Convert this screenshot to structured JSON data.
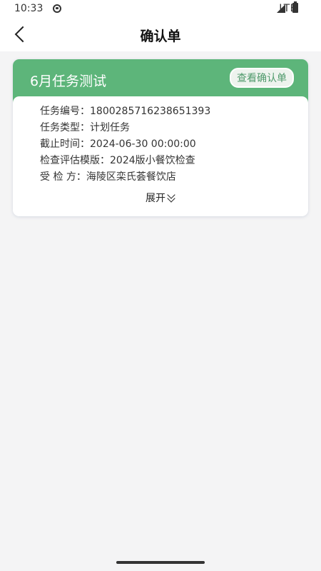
{
  "status_bar": {
    "time": "10:33",
    "network": "LTE",
    "icons": [
      "app-notification-icon",
      "signal-icon",
      "battery-icon"
    ]
  },
  "nav": {
    "title": "确认单",
    "back_icon": "chevron-left-icon"
  },
  "card": {
    "title": "6月任务测试",
    "view_button_label": "查看确认单",
    "rows": [
      {
        "label": "任务编号：",
        "value": "1800285716238651393"
      },
      {
        "label": "任务类型：",
        "value": "计划任务"
      },
      {
        "label": "截止时间：",
        "value": "2024-06-30 00:00:00"
      },
      {
        "label": "检查评估模版：",
        "value": "2024版小餐饮检查"
      },
      {
        "label": "受 检 方：",
        "value": "海陵区栾氏荟餐饮店"
      }
    ],
    "expand_label": "展开"
  },
  "colors": {
    "header_green": "#5db57a",
    "background": "#f4f4f5"
  }
}
